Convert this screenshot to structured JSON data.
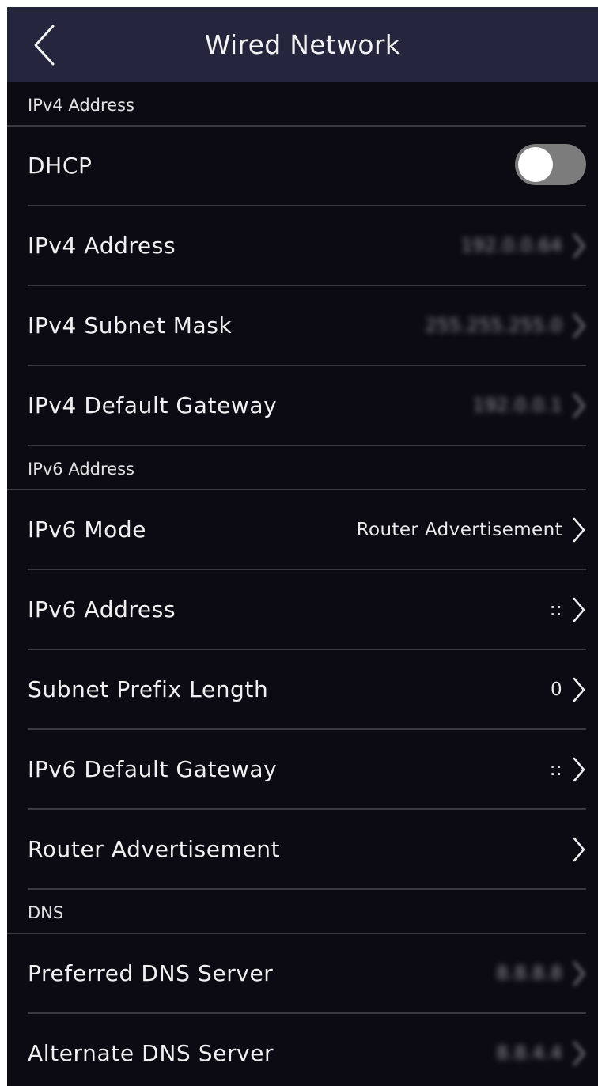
{
  "header": {
    "title": "Wired Network",
    "back_icon": "chevron-left-icon"
  },
  "sections": {
    "ipv4": {
      "title": "IPv4 Address",
      "dhcp": {
        "label": "DHCP",
        "enabled": false
      },
      "address": {
        "label": "IPv4 Address",
        "value": "192.0.0.64"
      },
      "subnet_mask": {
        "label": "IPv4 Subnet Mask",
        "value": "255.255.255.0"
      },
      "default_gateway": {
        "label": "IPv4 Default Gateway",
        "value": "192.0.0.1"
      }
    },
    "ipv6": {
      "title": "IPv6 Address",
      "mode": {
        "label": "IPv6 Mode",
        "value": "Router Advertisement"
      },
      "address": {
        "label": "IPv6 Address",
        "value": "::"
      },
      "prefix_length": {
        "label": "Subnet Prefix Length",
        "value": "0"
      },
      "default_gateway": {
        "label": "IPv6 Default Gateway",
        "value": "::"
      },
      "router_advertisement": {
        "label": "Router Advertisement"
      }
    },
    "dns": {
      "title": "DNS",
      "preferred": {
        "label": "Preferred DNS Server",
        "value": "8.8.8.8"
      },
      "alternate": {
        "label": "Alternate DNS Server",
        "value": "8.8.4.4"
      }
    }
  },
  "colors": {
    "background": "#0c0a12",
    "header": "#25253d",
    "divider": "#3a3a45",
    "toggle_off": "#7c7c7c"
  }
}
